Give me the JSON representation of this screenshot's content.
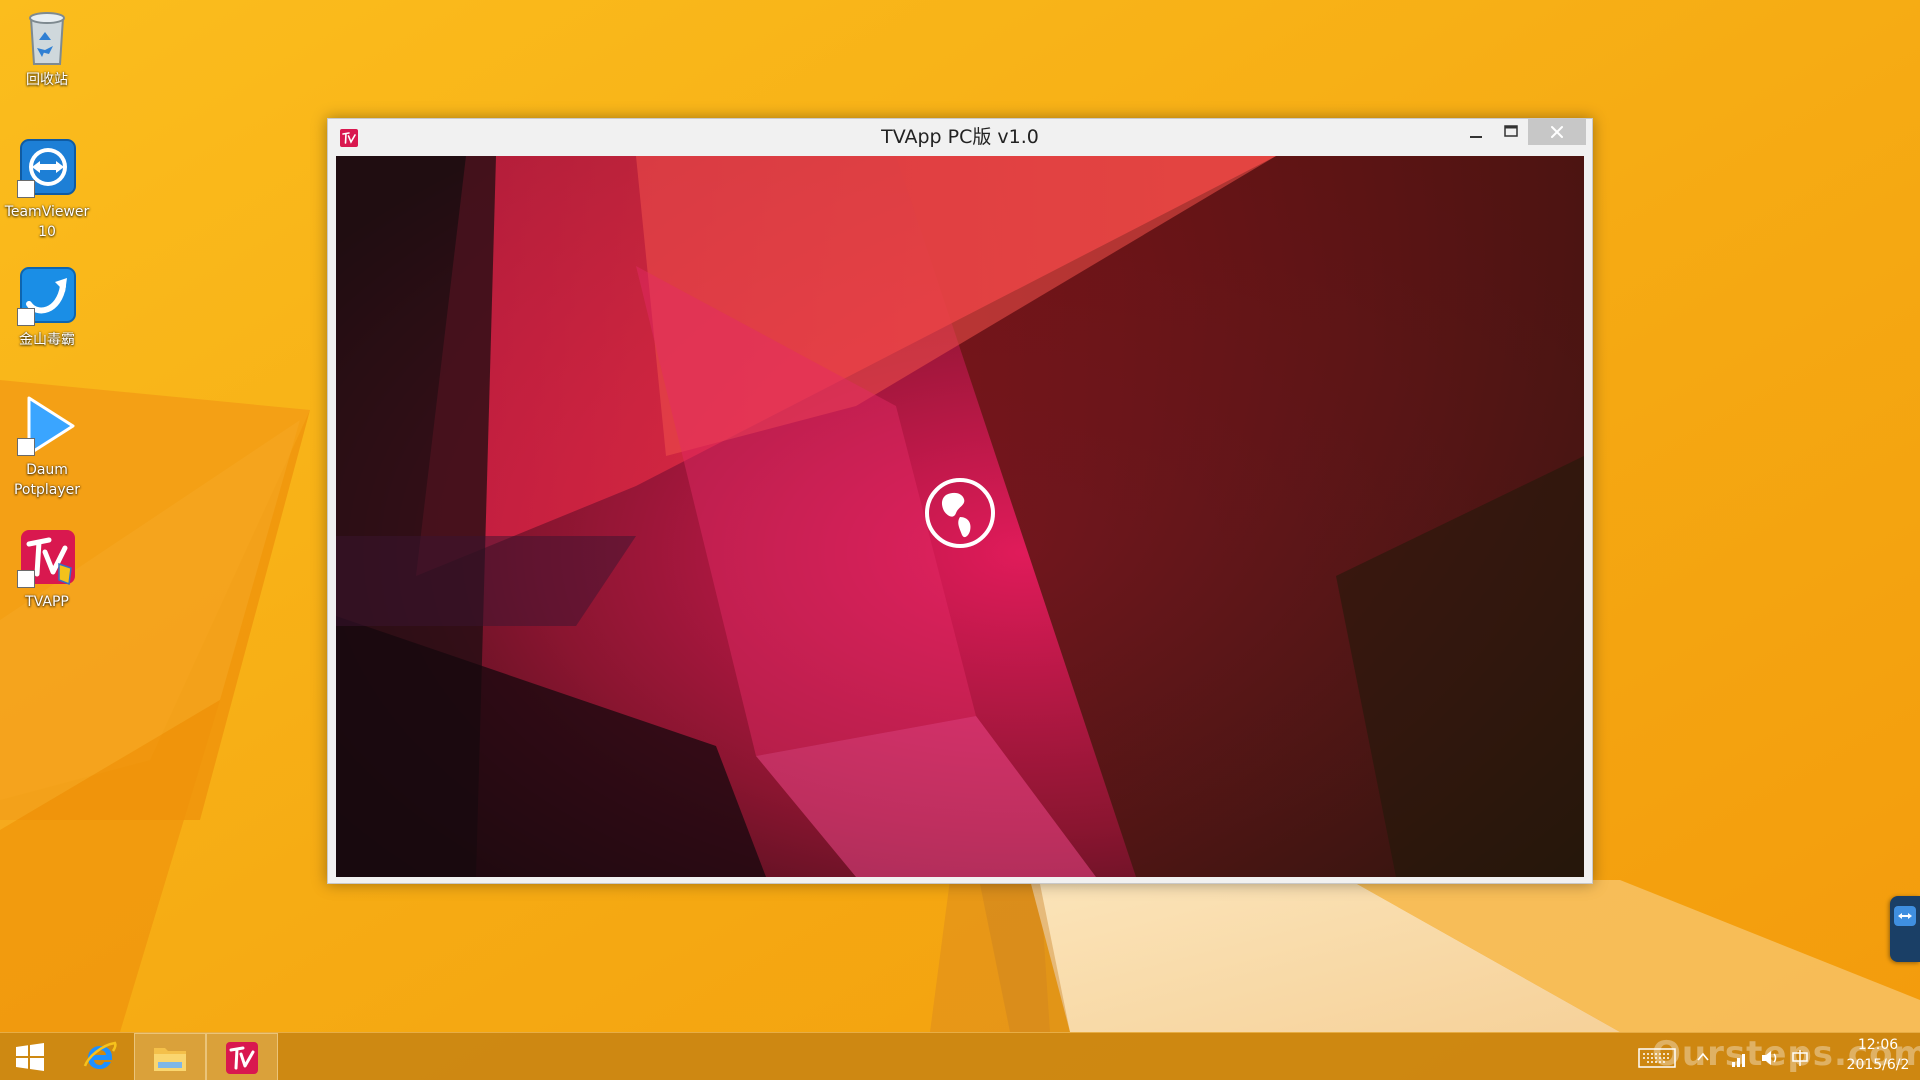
{
  "desktop": {
    "icons": [
      {
        "label": "回收站",
        "icon": "recycle-bin-icon"
      },
      {
        "label": "TeamViewer\n10",
        "icon": "teamviewer-icon"
      },
      {
        "label": "金山毒霸",
        "icon": "kingsoft-antivirus-icon"
      },
      {
        "label": "Daum\nPotplayer",
        "icon": "potplayer-icon"
      },
      {
        "label": "TVAPP",
        "icon": "tvapp-icon"
      }
    ]
  },
  "window": {
    "title": "TVApp PC版 v1.0",
    "controls": [
      "minimize",
      "maximize",
      "close"
    ],
    "content_icon": "globe-icon"
  },
  "taskbar": {
    "items": [
      "start-icon",
      "internet-explorer-icon",
      "file-explorer-icon",
      "tvapp-icon"
    ],
    "tray": {
      "icons": [
        "keyboard-icon",
        "show-hidden-icons-icon",
        "network-icon",
        "volume-icon",
        "ime-icon"
      ],
      "time": "12:06",
      "date": "2015/6/2"
    }
  },
  "watermark": "Oursteps.com.au",
  "colors": {
    "wallpaper": "#f6ae16",
    "taskbar": "#c88412",
    "accent_pink": "#e01b5a",
    "close_button": "#c7c7c7"
  }
}
